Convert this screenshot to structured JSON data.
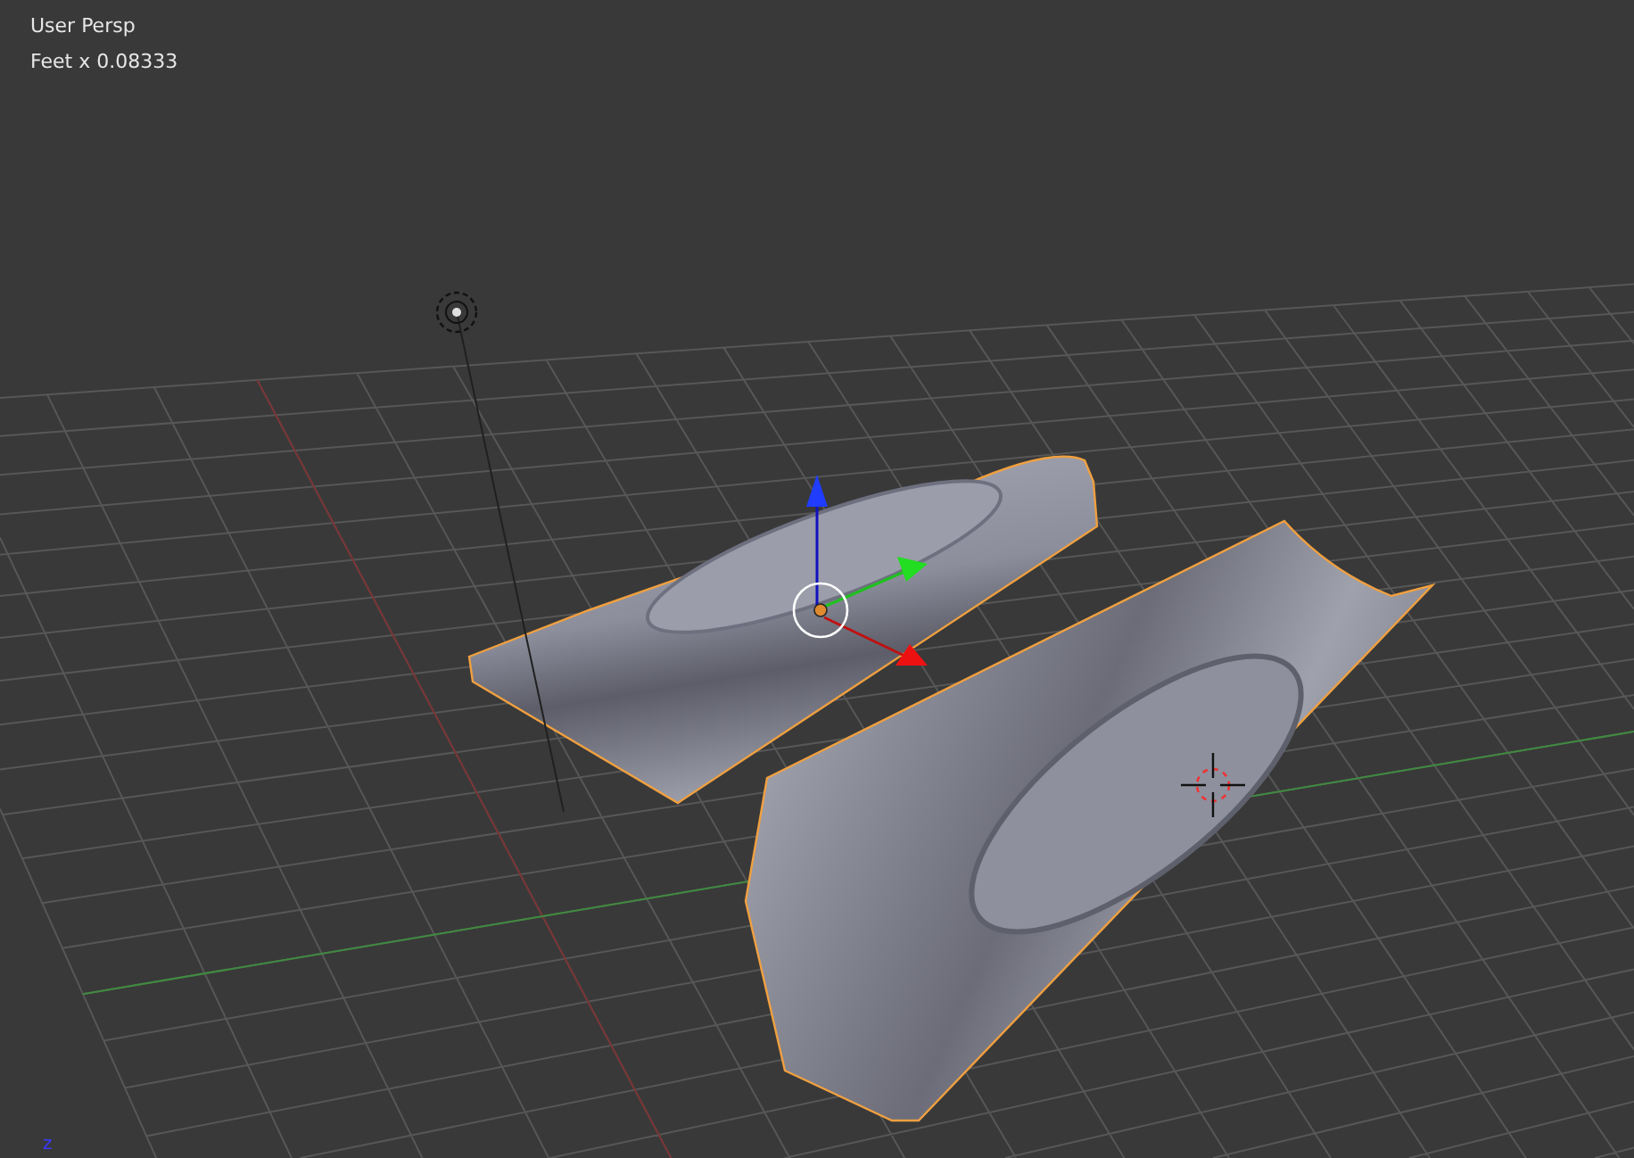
{
  "viewport": {
    "view_name": "User Persp",
    "units": "Feet x 0.08333",
    "axis_label": "z"
  }
}
